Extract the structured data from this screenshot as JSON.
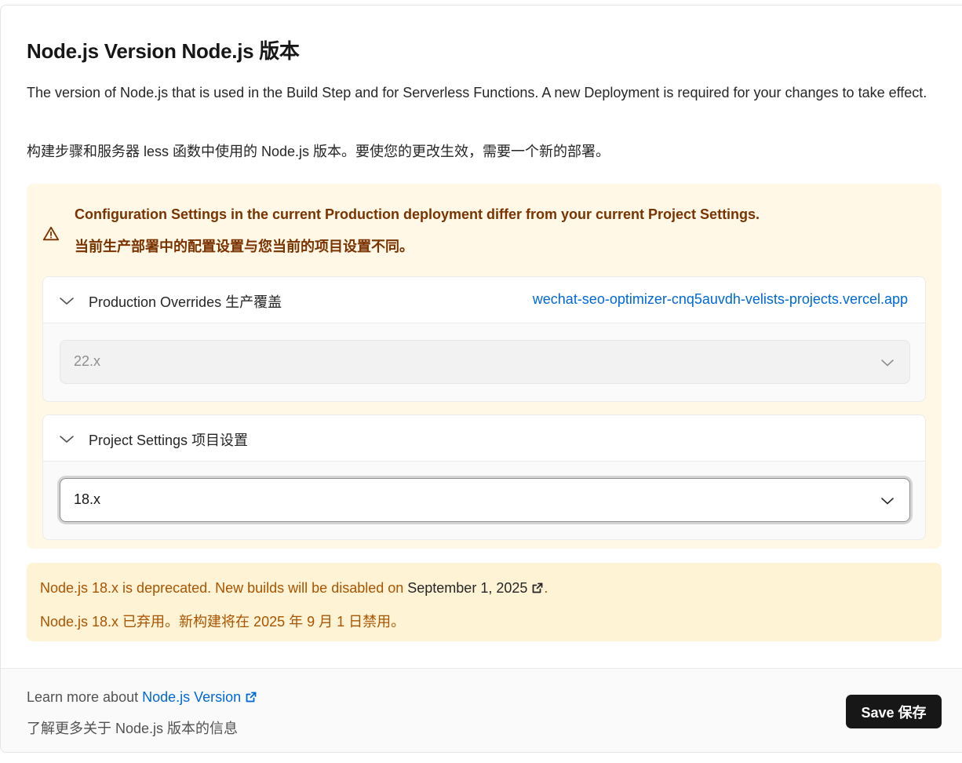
{
  "section": {
    "title": "Node.js Version  Node.js 版本",
    "description_en": "The version of Node.js that is used in the Build Step and for Serverless Functions. A new Deployment is required for your changes to take effect.",
    "description_zh": "构建步骤和服务器 less 函数中使用的 Node.js 版本。要使您的更改生效，需要一个新的部署。"
  },
  "warning": {
    "icon": "warning-triangle-icon",
    "message_en": "Configuration Settings in the current Production deployment differ from your current Project Settings.",
    "message_zh": "当前生产部署中的配置设置与您当前的项目设置不同。",
    "color": "#7a3300"
  },
  "production_overrides": {
    "label": "Production Overrides  生产覆盖",
    "deployment_link": "wechat-seo-optimizer-cnq5auvdh-velists-projects.vercel.app",
    "value": "22.x"
  },
  "project_settings": {
    "label": "Project Settings  项目设置",
    "value": "18.x"
  },
  "deprecation": {
    "text_en_before": "Node.js 18.x is deprecated. New builds will be disabled on ",
    "date_link": "September 1, 2025",
    "text_en_after": ".",
    "text_zh": "Node.js 18.x 已弃用。新构建将在 2025 年 9 月 1 日禁用。",
    "color": "#a85400"
  },
  "footer": {
    "learn_prefix": "Learn more about ",
    "learn_link": "Node.js Version",
    "learn_zh": "了解更多关于 Node.js 版本的信息",
    "save_label": "Save  保存"
  },
  "colors": {
    "link": "#0068d6",
    "warning_bg": "#fff8e6",
    "deprecation_bg": "#fff3d6",
    "button_bg": "#171717"
  }
}
